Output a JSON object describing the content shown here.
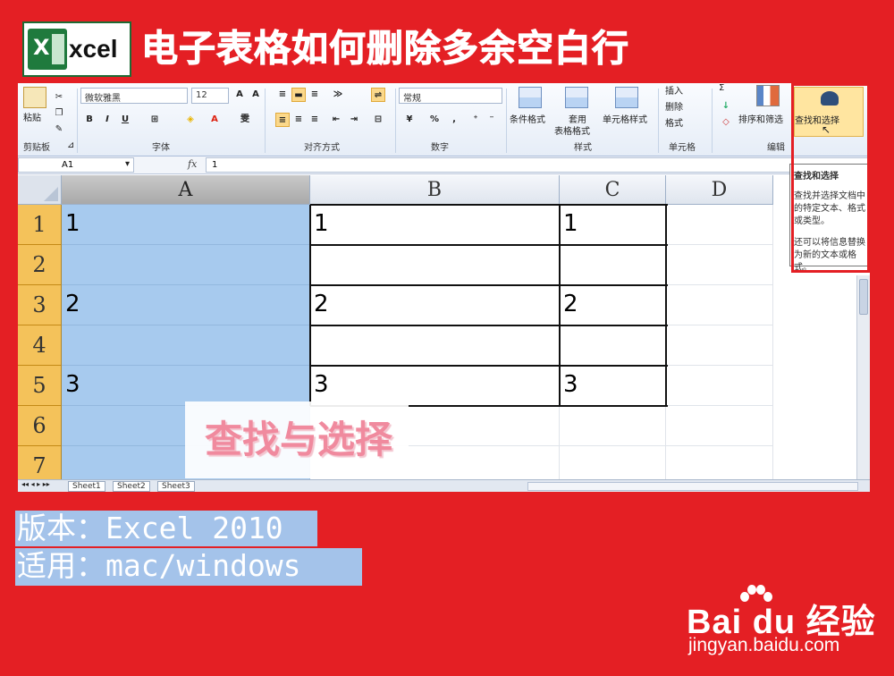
{
  "banner": {
    "logo_text": "xcel",
    "logo_letter": "X",
    "title": "电子表格如何删除多余空白行"
  },
  "ribbon": {
    "paste_label": "粘贴",
    "clipboard_group": "剪贴板",
    "font_name": "微软雅黑",
    "font_size": "12",
    "bold": "B",
    "italic": "I",
    "underline": "U",
    "font_group": "字体",
    "wen_label": "雯",
    "align_group": "对齐方式",
    "number_format": "常规",
    "percent": "%",
    "comma": ",",
    "number_group": "数字",
    "cond_format": "条件格式",
    "table_format_1": "套用",
    "table_format_2": "表格格式",
    "cell_style": "单元格样式",
    "style_group": "样式",
    "insert": "插入",
    "delete": "删除",
    "format": "格式",
    "cells_group": "单元格",
    "sigma": "Σ",
    "sort_filter": "排序和筛选",
    "find_select": "查找和选择",
    "edit_group": "编辑"
  },
  "formula_bar": {
    "name_box": "A1",
    "fx": "fx",
    "value": "1"
  },
  "grid": {
    "columns": [
      "A",
      "B",
      "C",
      "D"
    ],
    "rows": [
      "1",
      "2",
      "3",
      "4",
      "5",
      "6",
      "7"
    ],
    "cells": [
      [
        "1",
        "1",
        "1"
      ],
      [
        "",
        "",
        ""
      ],
      [
        "2",
        "2",
        "2"
      ],
      [
        "",
        "",
        ""
      ],
      [
        "3",
        "3",
        "3"
      ]
    ],
    "overlay_text": "查找与选择"
  },
  "tooltip": {
    "title": "查找和选择",
    "body_1": "查找并选择文档中的特定文本、格式或类型。",
    "body_2": "还可以将信息替换为新的文本或格式。"
  },
  "sheet_tabs": [
    "Sheet1",
    "Sheet2",
    "Sheet3"
  ],
  "captions": {
    "version": "版本：Excel 2010",
    "applies": "适用：mac/windows"
  },
  "watermark": {
    "brand": "Bai du 经验",
    "url": "jingyan.baidu.com"
  },
  "colors": {
    "background": "#e41f24",
    "selection": "#a7caee",
    "row_header": "#f4c25a",
    "caption_bg": "#a4c3ea"
  }
}
